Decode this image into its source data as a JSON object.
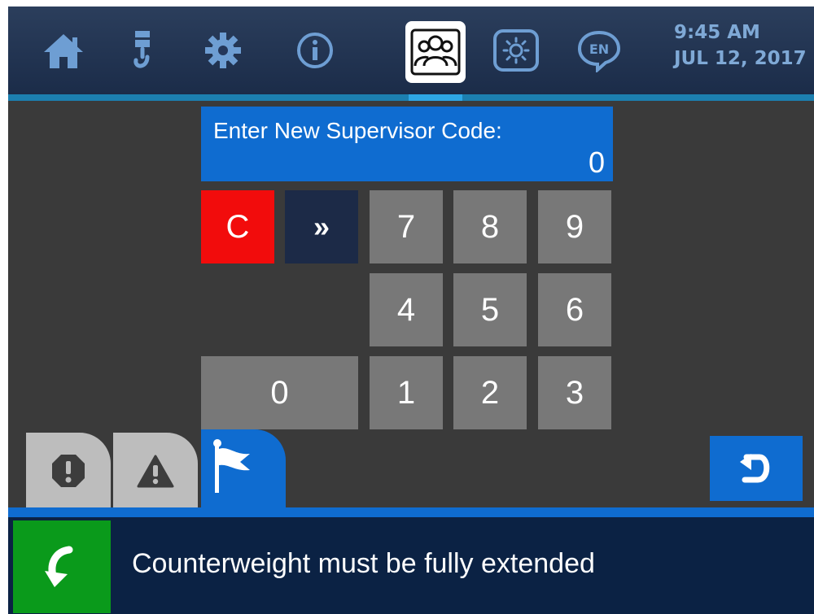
{
  "header": {
    "nav": [
      {
        "icon": "home-icon"
      },
      {
        "icon": "hook-icon"
      },
      {
        "icon": "gear-icon"
      },
      {
        "icon": "info-icon"
      },
      {
        "icon": "users-icon",
        "active": true
      },
      {
        "icon": "brightness-icon"
      },
      {
        "icon": "language-icon",
        "label": "EN"
      }
    ],
    "time": "9:45 AM",
    "date": "JUL 12, 2017"
  },
  "entry": {
    "label": "Enter New Supervisor Code:",
    "value": "0"
  },
  "keypad": {
    "clear": "C",
    "next": "»",
    "digits": [
      "7",
      "8",
      "9",
      "4",
      "5",
      "6",
      "0",
      "1",
      "2",
      "3"
    ]
  },
  "tabs": [
    {
      "icon": "stop-alert-icon"
    },
    {
      "icon": "warning-icon"
    },
    {
      "icon": "flag-icon",
      "active": true
    }
  ],
  "status": {
    "message": "Counterweight must be fully extended",
    "icon": "rotate-arrow-icon",
    "color": "#0a9a1b"
  },
  "colors": {
    "accent": "#0f6cd0",
    "clear_key": "#f20c0c",
    "key": "#787878"
  }
}
